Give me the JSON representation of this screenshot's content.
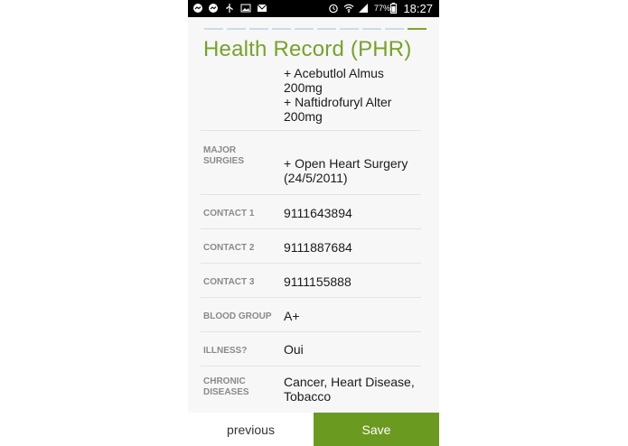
{
  "status_bar": {
    "battery": "77%",
    "time": "18:27",
    "icons": [
      "messenger-icon",
      "messenger-icon",
      "usb-icon",
      "image-icon",
      "mail-icon",
      "alarm-icon",
      "wifi-icon",
      "signal-icon",
      "battery-icon"
    ]
  },
  "header": {
    "title": "Health Record (PHR)",
    "progress_steps": 10,
    "progress_active_step": 10
  },
  "record": {
    "medications": {
      "label": "",
      "value": "+ Acebutlol Almus\n200mg\n + Naftidrofuryl Alter\n200mg"
    },
    "major_surgeries": {
      "label": "MAJOR SURGIES",
      "value": "+ Open Heart Surgery\n(24/5/2011)"
    },
    "contact1": {
      "label": "CONTACT 1",
      "value": "9111643894"
    },
    "contact2": {
      "label": "CONTACT 2",
      "value": "9111887684"
    },
    "contact3": {
      "label": "CONTACT 3",
      "value": "9111155888"
    },
    "blood_group": {
      "label": "BLOOD GROUP",
      "value": "A+"
    },
    "illness": {
      "label": "ILLNESS?",
      "value": "Oui"
    },
    "chronic": {
      "label": "CHRONIC DISEASES",
      "value": "Cancer, Heart Disease,\nTobacco"
    }
  },
  "footer": {
    "previous_label": "previous",
    "save_label": "Save"
  },
  "colors": {
    "accent": "#77a22a",
    "save_bg": "#6a9a1f",
    "progress_inactive": "#c9dde6"
  }
}
